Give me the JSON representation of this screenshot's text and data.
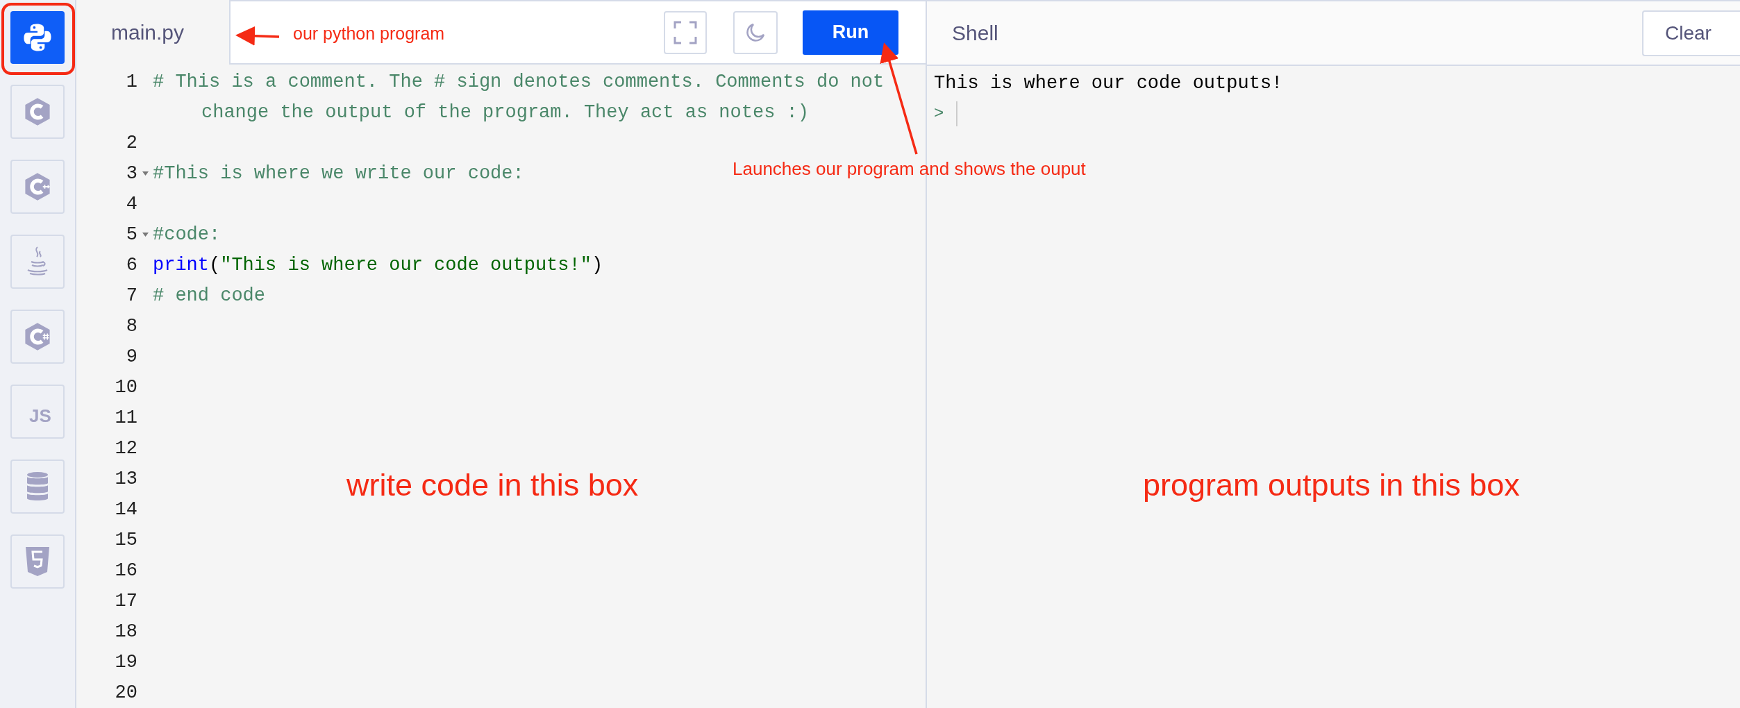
{
  "sidebar": {
    "items": [
      {
        "kind": "python",
        "selected": true
      },
      {
        "kind": "c",
        "selected": false
      },
      {
        "kind": "cpp",
        "selected": false
      },
      {
        "kind": "java",
        "selected": false
      },
      {
        "kind": "csharp",
        "selected": false
      },
      {
        "kind": "js",
        "label": "JS",
        "selected": false
      },
      {
        "kind": "database",
        "selected": false
      },
      {
        "kind": "html5",
        "selected": false
      }
    ]
  },
  "editor": {
    "tab": "main.py",
    "run_button": "Run",
    "lines": [
      {
        "number": "1",
        "foldable": false,
        "tokens": [
          {
            "kind": "comment",
            "text": "# This is a comment. The # sign denotes comments. Comments do not change the output of the program. They act as notes :)"
          }
        ]
      },
      {
        "number": "2",
        "foldable": false
      },
      {
        "number": "3",
        "foldable": true,
        "tokens": [
          {
            "kind": "comment",
            "text": "#This is where we write our code:"
          }
        ]
      },
      {
        "number": "4",
        "foldable": false
      },
      {
        "number": "5",
        "foldable": true,
        "tokens": [
          {
            "kind": "comment",
            "text": "#code:"
          }
        ]
      },
      {
        "number": "6",
        "foldable": false,
        "tokens": [
          {
            "kind": "keyword",
            "text": "print"
          },
          {
            "kind": "plain",
            "text": "("
          },
          {
            "kind": "string",
            "text": "\"This is where our code outputs!\""
          },
          {
            "kind": "plain",
            "text": ")"
          }
        ]
      },
      {
        "number": "7",
        "foldable": false,
        "tokens": [
          {
            "kind": "comment",
            "text": "# end code"
          }
        ]
      },
      {
        "number": "8",
        "foldable": false
      },
      {
        "number": "9",
        "foldable": false
      },
      {
        "number": "10",
        "foldable": false
      },
      {
        "number": "11",
        "foldable": false
      },
      {
        "number": "12",
        "foldable": false
      },
      {
        "number": "13",
        "foldable": false
      },
      {
        "number": "14",
        "foldable": false
      },
      {
        "number": "15",
        "foldable": false
      },
      {
        "number": "16",
        "foldable": false
      },
      {
        "number": "17",
        "foldable": false
      },
      {
        "number": "18",
        "foldable": false
      },
      {
        "number": "19",
        "foldable": false
      },
      {
        "number": "20",
        "foldable": false
      }
    ]
  },
  "shell": {
    "title": "Shell",
    "clear_button": "Clear",
    "output": [
      "This is where our code outputs!"
    ],
    "prompt": ">"
  },
  "annotations": [
    {
      "kind": "tab_note",
      "text": "our python program"
    },
    {
      "kind": "run_note",
      "text": "Launches our program and shows the ouput"
    },
    {
      "kind": "editor_note",
      "text": "write code in this box"
    },
    {
      "kind": "shell_note",
      "text": "program outputs in this box"
    }
  ]
}
